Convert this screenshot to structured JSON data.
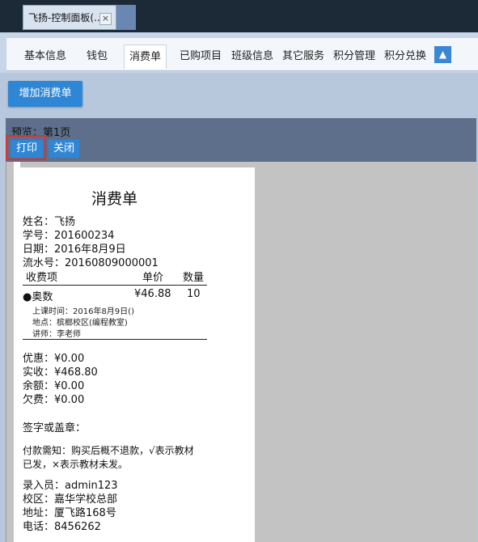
{
  "browser_tab": {
    "title": "飞扬-控制面板(...",
    "close": "×"
  },
  "nav": {
    "items": [
      "基本信息",
      "钱包",
      "消费单",
      "已购项目",
      "班级信息",
      "其它服务",
      "积分管理",
      "积分兑换"
    ],
    "active": "消费单",
    "up_arrow": "▲"
  },
  "toolbar": {
    "add_label": "增加消费单"
  },
  "preview": {
    "title": "预览：第1页",
    "print_label": "打印",
    "close_label": "关闭"
  },
  "receipt": {
    "title": "消费单",
    "name": "姓名：飞扬",
    "student_no": "学号：201600234",
    "date": "日期：2016年8月9日",
    "serial": "流水号：20160809000001",
    "table_headers": [
      "收费项",
      "单价",
      "数量"
    ],
    "item": {
      "name": "●奥数",
      "price": "¥46.88",
      "qty": "10"
    },
    "item_details": [
      "上课时间：2016年8月9日()",
      "地点：槟榔校区(编程教室)",
      "讲师：李老师"
    ],
    "discount": "优惠：¥0.00",
    "received": "实收：¥468.80",
    "balance": "余额：¥0.00",
    "owed": "欠费：¥0.00",
    "signature": "签字或盖章：",
    "notice_line1": "付款需知：购买后概不退款，√表示教材",
    "notice_line2": "已发，×表示教材未发。",
    "clerk": "录入员：admin123",
    "campus": "校区：嘉华学校总部",
    "address": "地址：厦飞路168号",
    "phone": "电话：8456262"
  }
}
